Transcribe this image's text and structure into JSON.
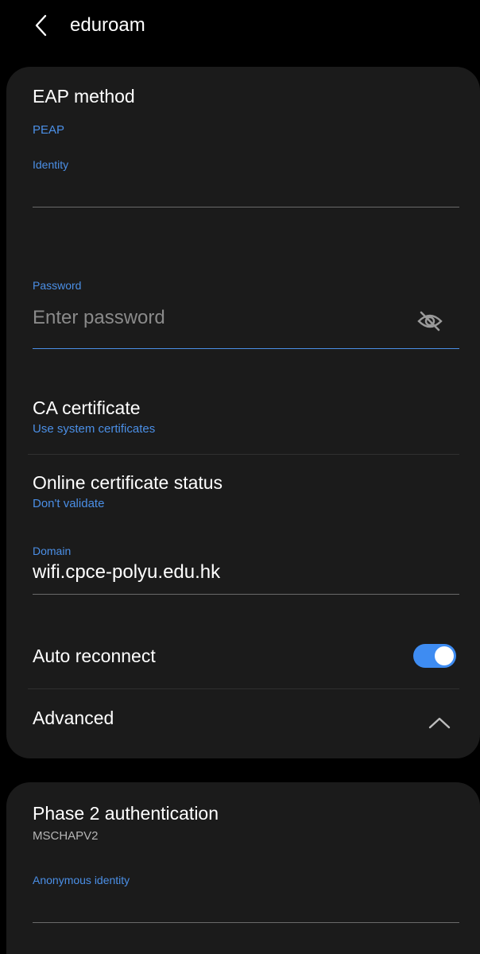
{
  "header": {
    "title": "eduroam"
  },
  "eap": {
    "title": "EAP method",
    "value": "PEAP"
  },
  "identity": {
    "label": "Identity",
    "value": ""
  },
  "password": {
    "label": "Password",
    "placeholder": "Enter password",
    "icon": "eye-off-icon"
  },
  "ca_certificate": {
    "title": "CA certificate",
    "value": "Use system certificates"
  },
  "online_cert": {
    "title": "Online certificate status",
    "value": "Don't validate"
  },
  "domain": {
    "label": "Domain",
    "value": "wifi.cpce-polyu.edu.hk"
  },
  "auto_reconnect": {
    "label": "Auto reconnect",
    "enabled": true
  },
  "advanced": {
    "label": "Advanced",
    "icon": "chevron-up-icon"
  },
  "phase2": {
    "title": "Phase 2 authentication",
    "value": "MSCHAPV2"
  },
  "anonymous_identity": {
    "label": "Anonymous identity",
    "value": ""
  },
  "colors": {
    "background": "#000000",
    "card": "#1b1b1b",
    "accent": "#4b8fe6",
    "toggle_on": "#3e8cf2"
  }
}
